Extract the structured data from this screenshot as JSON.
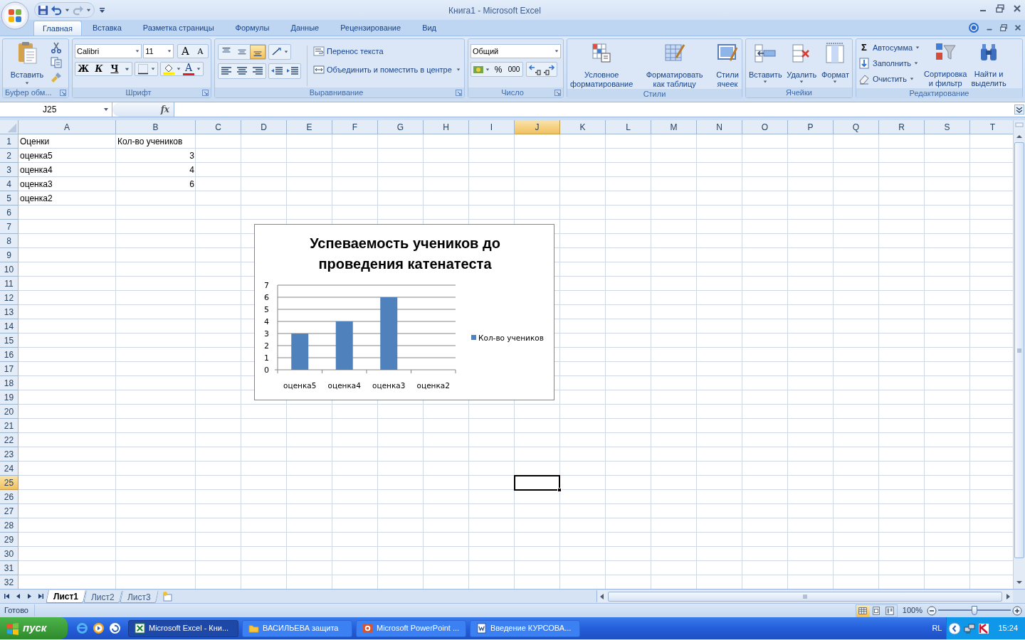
{
  "window": {
    "title": "Книга1 - Microsoft Excel"
  },
  "tabs": [
    {
      "label": "Главная",
      "selected": true
    },
    {
      "label": "Вставка",
      "selected": false
    },
    {
      "label": "Разметка страницы",
      "selected": false
    },
    {
      "label": "Формулы",
      "selected": false
    },
    {
      "label": "Данные",
      "selected": false
    },
    {
      "label": "Рецензирование",
      "selected": false
    },
    {
      "label": "Вид",
      "selected": false
    }
  ],
  "ribbon": {
    "clipboard": {
      "paste": "Вставить",
      "label": "Буфер обм..."
    },
    "font": {
      "name": "Calibri",
      "size": "11",
      "grow": "A",
      "shrink": "A",
      "bold": "Ж",
      "italic": "К",
      "underline": "Ч",
      "font_tint_button": "A",
      "label": "Шрифт"
    },
    "alignment": {
      "vertical": [
        {
          "selected": false
        },
        {
          "selected": false
        },
        {
          "selected": true
        }
      ],
      "wrap": "Перенос текста",
      "merge": "Объединить и поместить в центре",
      "label": "Выравнивание"
    },
    "number": {
      "format": "Общий",
      "percent": "%",
      "thousands": "000",
      "label": "Число"
    },
    "styles": {
      "buttons": [
        "Условное\nформатирование",
        "Форматировать\nкак таблицу",
        "Стили\nячеек"
      ],
      "label": "Стили"
    },
    "cells": {
      "buttons": [
        "Вставить",
        "Удалить",
        "Формат"
      ],
      "label": "Ячейки"
    },
    "editing": {
      "autosum_sign": "Σ",
      "small": [
        "Автосумма",
        "Заполнить",
        "Очистить"
      ],
      "large": [
        "Сортировка\nи фильтр",
        "Найти и\nвыделить"
      ],
      "label": "Редактирование"
    }
  },
  "formula_bar": {
    "name_box": "J25",
    "fx": "fx"
  },
  "columns": [
    {
      "label": "A",
      "selected": false
    },
    {
      "label": "B",
      "selected": false
    },
    {
      "label": "C",
      "selected": false
    },
    {
      "label": "D",
      "selected": false
    },
    {
      "label": "E",
      "selected": false
    },
    {
      "label": "F",
      "selected": false
    },
    {
      "label": "G",
      "selected": false
    },
    {
      "label": "H",
      "selected": false
    },
    {
      "label": "I",
      "selected": false
    },
    {
      "label": "J",
      "selected": true
    },
    {
      "label": "K",
      "selected": false
    },
    {
      "label": "L",
      "selected": false
    },
    {
      "label": "M",
      "selected": false
    },
    {
      "label": "N",
      "selected": false
    },
    {
      "label": "O",
      "selected": false
    },
    {
      "label": "P",
      "selected": false
    },
    {
      "label": "Q",
      "selected": false
    },
    {
      "label": "R",
      "selected": false
    },
    {
      "label": "S",
      "selected": false
    },
    {
      "label": "T",
      "selected": false
    }
  ],
  "rows": [
    {
      "label": "1",
      "selected": false,
      "cells": [
        {
          "text": "Оценки",
          "kind": "text"
        },
        {
          "text": "Кол-во учеников",
          "kind": "text"
        }
      ]
    },
    {
      "label": "2",
      "selected": false,
      "cells": [
        {
          "text": "оценка5",
          "kind": "text"
        },
        {
          "text": "3",
          "kind": "number"
        }
      ]
    },
    {
      "label": "3",
      "selected": false,
      "cells": [
        {
          "text": "оценка4",
          "kind": "text"
        },
        {
          "text": "4",
          "kind": "number"
        }
      ]
    },
    {
      "label": "4",
      "selected": false,
      "cells": [
        {
          "text": "оценка3",
          "kind": "text"
        },
        {
          "text": "6",
          "kind": "number"
        }
      ]
    },
    {
      "label": "5",
      "selected": false,
      "cells": [
        {
          "text": "оценка2",
          "kind": "text"
        }
      ]
    },
    {
      "label": "6",
      "selected": false
    },
    {
      "label": "7",
      "selected": false
    },
    {
      "label": "8",
      "selected": false
    },
    {
      "label": "9",
      "selected": false
    },
    {
      "label": "10",
      "selected": false
    },
    {
      "label": "11",
      "selected": false
    },
    {
      "label": "12",
      "selected": false
    },
    {
      "label": "13",
      "selected": false
    },
    {
      "label": "14",
      "selected": false
    },
    {
      "label": "15",
      "selected": false
    },
    {
      "label": "16",
      "selected": false
    },
    {
      "label": "17",
      "selected": false
    },
    {
      "label": "18",
      "selected": false
    },
    {
      "label": "19",
      "selected": false
    },
    {
      "label": "20",
      "selected": false
    },
    {
      "label": "21",
      "selected": false
    },
    {
      "label": "22",
      "selected": false
    },
    {
      "label": "23",
      "selected": false
    },
    {
      "label": "24",
      "selected": false
    },
    {
      "label": "25",
      "selected": true
    },
    {
      "label": "26",
      "selected": false
    },
    {
      "label": "27",
      "selected": false
    },
    {
      "label": "28",
      "selected": false
    },
    {
      "label": "29",
      "selected": false
    },
    {
      "label": "30",
      "selected": false
    },
    {
      "label": "31",
      "selected": false
    },
    {
      "label": "32",
      "selected": false
    }
  ],
  "chart_data": {
    "type": "bar",
    "title": "Успеваемость учеников до проведения катенатеста",
    "categories": [
      "оценка5",
      "оценка4",
      "оценка3",
      "оценка2"
    ],
    "series": [
      {
        "name": "Кол-во учеников",
        "color": "#4f81bd",
        "values": [
          3,
          4,
          6,
          null
        ]
      }
    ],
    "ylim": [
      0,
      7
    ],
    "yticks": [
      0,
      1,
      2,
      3,
      4,
      5,
      6,
      7
    ],
    "grid": true
  },
  "sheet_tabs": [
    {
      "label": "Лист1",
      "selected": true
    },
    {
      "label": "Лист2",
      "selected": false
    },
    {
      "label": "Лист3",
      "selected": false
    }
  ],
  "status_bar": {
    "text": "Готово",
    "views": [
      {
        "selected": true
      },
      {
        "selected": false
      },
      {
        "selected": false
      }
    ],
    "zoom": "100%",
    "zoom_slider": {
      "level": 0.5
    }
  },
  "taskbar": {
    "start": "пуск",
    "items": [
      {
        "label": "Microsoft Excel - Кни...",
        "selected": true
      },
      {
        "label": "ВАСИЛЬЕВА защита",
        "selected": false
      },
      {
        "label": "Microsoft PowerPoint ...",
        "selected": false
      },
      {
        "label": "Введение КУРСОВА...",
        "selected": false
      }
    ],
    "language": "RL",
    "clock": "15:24"
  }
}
